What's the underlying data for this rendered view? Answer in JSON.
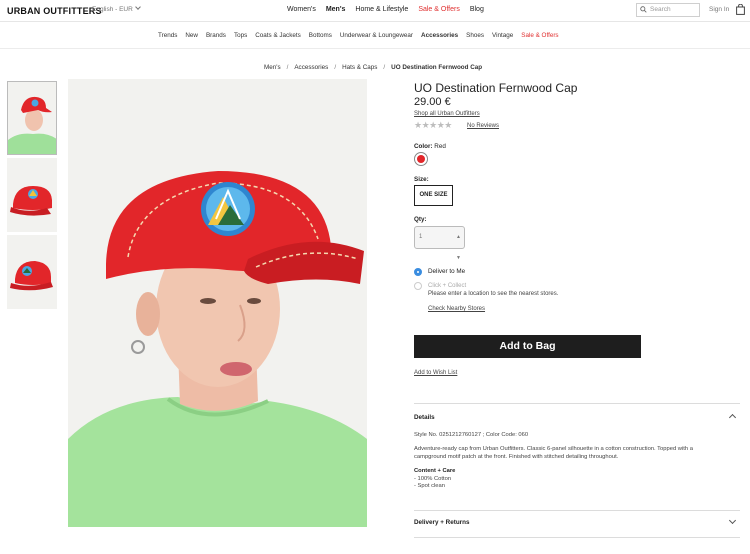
{
  "header": {
    "logo": "URBAN OUTFITTERS",
    "language": "English - EUR",
    "nav": [
      "Women's",
      "Men's",
      "Home & Lifestyle",
      "Sale & Offers",
      "Blog"
    ],
    "search_placeholder": "Search",
    "signin": "Sign In"
  },
  "categories": [
    "Trends",
    "New",
    "Brands",
    "Tops",
    "Coats & Jackets",
    "Bottoms",
    "Underwear & Loungewear",
    "Accessories",
    "Shoes",
    "Vintage",
    "Sale & Offers"
  ],
  "breadcrumb": [
    "Men's",
    "Accessories",
    "Hats & Caps",
    "UO Destination Fernwood Cap"
  ],
  "breadcrumb_sep": "/",
  "product": {
    "title": "UO Destination Fernwood Cap",
    "price": "29.00 €",
    "shop_all": "Shop all Urban Outfitters",
    "stars": "★★★★★",
    "reviews": "No Reviews",
    "color_label": "Color:",
    "color_value": "Red",
    "swatch_color": "#e2262a",
    "size_label": "Size:",
    "size_value": "ONE SIZE",
    "qty_label": "Qty:",
    "qty_value": "1",
    "deliver_label": "Deliver to Me",
    "collect_label": "Click + Collect",
    "collect_note": "Please enter a location to see the nearest stores.",
    "nearby": "Check Nearby Stores",
    "add_to_bag": "Add to Bag",
    "wishlist": "Add to Wish List"
  },
  "details": {
    "title": "Details",
    "style_no": "Style No. 0251212760127 ; Color Code: 060",
    "description": "Adventure-ready cap from Urban Outfitters. Classic 6-panel silhouette in a cotton construction. Topped with a campground motif patch at the front. Finished with stitched detailing throughout.",
    "care_title": "Content + Care",
    "care_items": [
      "- 100% Cotton",
      "- Spot clean"
    ]
  },
  "delivery": {
    "title": "Delivery + Returns"
  }
}
